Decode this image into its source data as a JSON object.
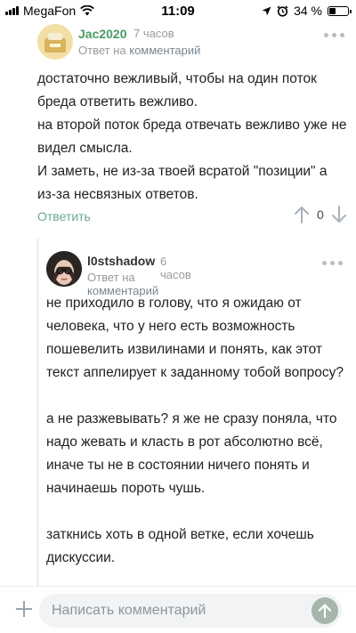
{
  "status_bar": {
    "carrier": "MegaFon",
    "time": "11:09",
    "battery": "34 %",
    "battery_level": 0.34
  },
  "comments": [
    {
      "author": "Jac2020",
      "ago": "7 часов",
      "reply_to_prefix": "Ответ на",
      "reply_to_link": "комментарий",
      "paragraphs": [
        "достаточно вежливый, чтобы на один поток бреда ответить вежливо.",
        "на второй поток бреда отвечать вежливо уже не видел смысла.",
        "И заметь, не из-за твоей всратой \"позиции\" а из-за несвязных ответов."
      ],
      "reply_label": "Ответить",
      "score": "0"
    },
    {
      "author": "l0stshadow",
      "ago": "6 часов",
      "reply_to_prefix": "Ответ на",
      "reply_to_link": "комментарий",
      "paragraphs": [
        "не приходило в голову, что я ожидаю от человека, что у него есть возможность пошевелить извилинами и понять, как этот текст аппелирует к заданному тобой вопросу?",
        "а не разжевывать? я же не сразу поняла, что надо жевать и класть в рот абсолютно всё, иначе ты не в состоянии ничего понять и начинаешь пороть чушь.",
        "заткнись хоть в одной ветке, если хочешь дискуссии."
      ]
    }
  ],
  "composer": {
    "placeholder": "Написать комментарий"
  },
  "colors": {
    "accent_green": "#6aa88c",
    "author_green": "#4a9a63",
    "muted": "#999999"
  }
}
